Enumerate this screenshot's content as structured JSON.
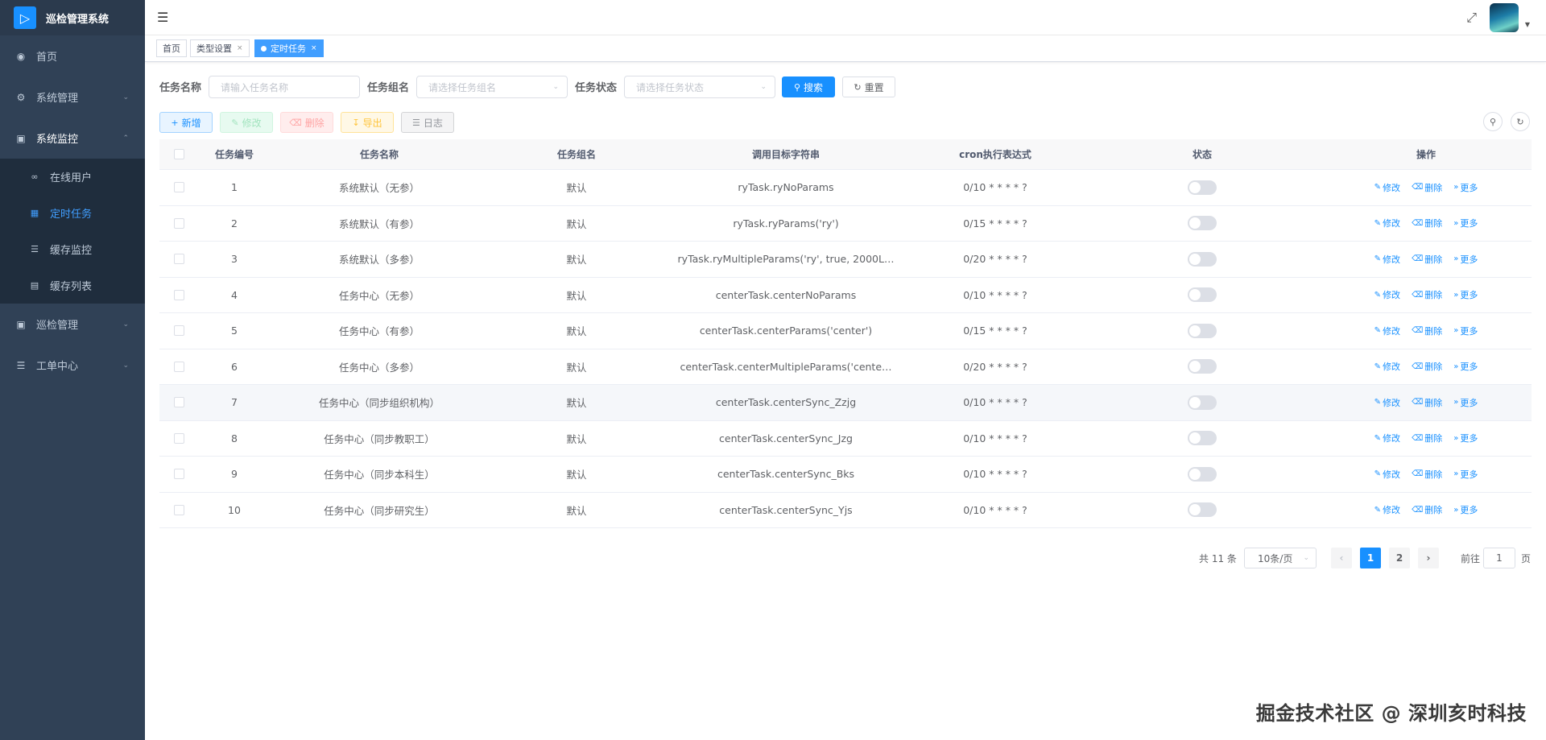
{
  "app": {
    "title": "巡检管理系统"
  },
  "sidebar": {
    "items": [
      {
        "label": "首页",
        "icon": "dashboard-icon"
      },
      {
        "label": "系统管理",
        "icon": "gear-icon"
      },
      {
        "label": "系统监控",
        "icon": "monitor-icon"
      },
      {
        "label": "巡检管理",
        "icon": "inspect-icon"
      },
      {
        "label": "工单中心",
        "icon": "list-icon"
      }
    ],
    "submenu": [
      {
        "label": "在线用户",
        "icon": "online-icon"
      },
      {
        "label": "定时任务",
        "icon": "job-icon"
      },
      {
        "label": "缓存监控",
        "icon": "redis-icon"
      },
      {
        "label": "缓存列表",
        "icon": "redis-list-icon"
      }
    ]
  },
  "tags": [
    {
      "label": "首页"
    },
    {
      "label": "类型设置"
    },
    {
      "label": "定时任务"
    }
  ],
  "search": {
    "name_label": "任务名称",
    "name_placeholder": "请输入任务名称",
    "group_label": "任务组名",
    "group_placeholder": "请选择任务组名",
    "status_label": "任务状态",
    "status_placeholder": "请选择任务状态",
    "search_button": "搜索",
    "reset_button": "重置"
  },
  "toolbar": {
    "add": "新增",
    "edit": "修改",
    "delete": "删除",
    "export": "导出",
    "log": "日志"
  },
  "table": {
    "headers": [
      "任务编号",
      "任务名称",
      "任务组名",
      "调用目标字符串",
      "cron执行表达式",
      "状态",
      "操作"
    ],
    "ops": {
      "edit": "修改",
      "delete": "删除",
      "more": "更多"
    },
    "rows": [
      {
        "id": "1",
        "name": "系统默认（无参）",
        "group": "默认",
        "target": "ryTask.ryNoParams",
        "cron": "0/10 * * * * ?"
      },
      {
        "id": "2",
        "name": "系统默认（有参）",
        "group": "默认",
        "target": "ryTask.ryParams('ry')",
        "cron": "0/15 * * * * ?"
      },
      {
        "id": "3",
        "name": "系统默认（多参）",
        "group": "默认",
        "target": "ryTask.ryMultipleParams('ry', true, 2000L…",
        "cron": "0/20 * * * * ?"
      },
      {
        "id": "4",
        "name": "任务中心（无参）",
        "group": "默认",
        "target": "centerTask.centerNoParams",
        "cron": "0/10 * * * * ?"
      },
      {
        "id": "5",
        "name": "任务中心（有参）",
        "group": "默认",
        "target": "centerTask.centerParams('center')",
        "cron": "0/15 * * * * ?"
      },
      {
        "id": "6",
        "name": "任务中心（多参）",
        "group": "默认",
        "target": "centerTask.centerMultipleParams('cente…",
        "cron": "0/20 * * * * ?"
      },
      {
        "id": "7",
        "name": "任务中心（同步组织机构）",
        "group": "默认",
        "target": "centerTask.centerSync_Zzjg",
        "cron": "0/10 * * * * ?"
      },
      {
        "id": "8",
        "name": "任务中心（同步教职工）",
        "group": "默认",
        "target": "centerTask.centerSync_Jzg",
        "cron": "0/10 * * * * ?"
      },
      {
        "id": "9",
        "name": "任务中心（同步本科生）",
        "group": "默认",
        "target": "centerTask.centerSync_Bks",
        "cron": "0/10 * * * * ?"
      },
      {
        "id": "10",
        "name": "任务中心（同步研究生）",
        "group": "默认",
        "target": "centerTask.centerSync_Yjs",
        "cron": "0/10 * * * * ?"
      }
    ]
  },
  "pagination": {
    "total": "共 11 条",
    "page_size": "10条/页",
    "pages": [
      "1",
      "2"
    ],
    "current": "1",
    "goto_label": "前往",
    "goto_value": "1",
    "page_suffix": "页"
  },
  "watermark": "掘金技术社区 @ 深圳亥时科技"
}
